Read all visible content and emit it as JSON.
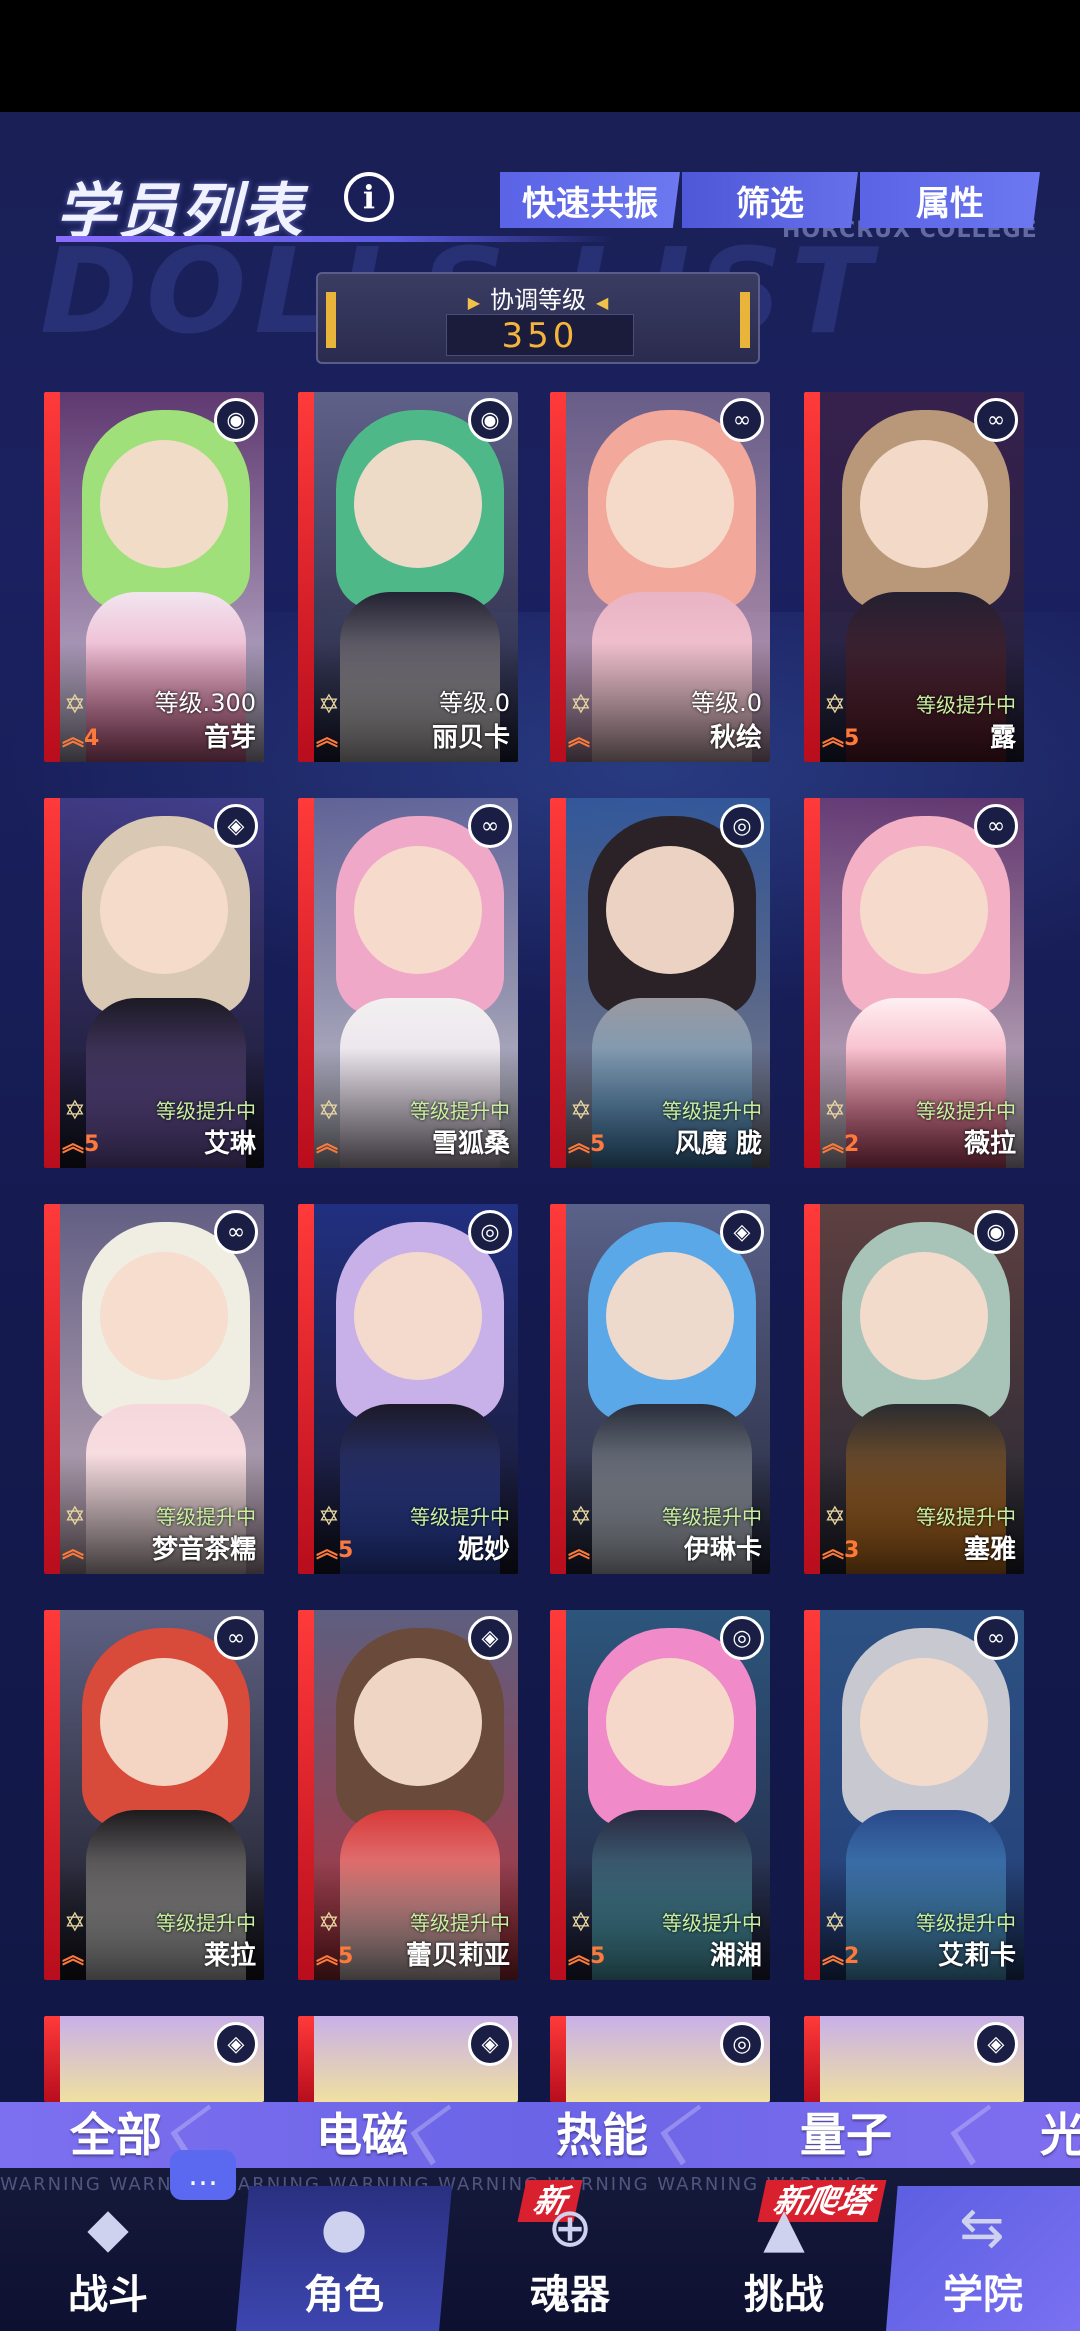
{
  "header": {
    "title": "学员列表",
    "subtitle_en": "HORCRUX COLLEGE",
    "watermark": "DOLLS LIST",
    "buttons": [
      "快速共振",
      "筛选",
      "属性"
    ]
  },
  "sync_level": {
    "label": "协调等级",
    "value": "350"
  },
  "characters": [
    {
      "name": "音芽",
      "status": "等级.300",
      "rank": "4",
      "element": "wifi-icon",
      "colors": [
        "#9fe07a",
        "#f2e6f0",
        "#e86a9a"
      ]
    },
    {
      "name": "丽贝卡",
      "status": "等级.0",
      "rank": "",
      "element": "wifi-icon",
      "colors": [
        "#4fb888",
        "#232232",
        "#e9e2e2"
      ]
    },
    {
      "name": "秋绘",
      "status": "等级.0",
      "rank": "",
      "element": "infinity-icon",
      "colors": [
        "#f2a89a",
        "#e9b4c4",
        "#ffd8e0"
      ]
    },
    {
      "name": "露",
      "status": "等级提升中",
      "rank": "5",
      "element": "infinity-icon",
      "colors": [
        "#b89878",
        "#242030",
        "#6e2230"
      ]
    },
    {
      "name": "艾琳",
      "status": "等级提升中",
      "rank": "5",
      "element": "diamond-icon",
      "colors": [
        "#d8c8b4",
        "#1c1a24",
        "#8a6ad0"
      ]
    },
    {
      "name": "雪狐桑",
      "status": "等级提升中",
      "rank": "",
      "element": "infinity-icon",
      "colors": [
        "#f0a8c8",
        "#f2f0f0",
        "#e0d0e8"
      ]
    },
    {
      "name": "风魔 胧",
      "status": "等级提升中",
      "rank": "5",
      "element": "spiral-icon",
      "colors": [
        "#2a2226",
        "#9a9aa0",
        "#4a9ad8"
      ]
    },
    {
      "name": "薇拉",
      "status": "等级提升中",
      "rank": "2",
      "element": "infinity-icon",
      "colors": [
        "#f4b0c4",
        "#fff0f2",
        "#e85078"
      ]
    },
    {
      "name": "梦音茶糯",
      "status": "等级提升中",
      "rank": "",
      "element": "infinity-icon",
      "colors": [
        "#f0ede2",
        "#f6d8dc",
        "#fbe6ea"
      ]
    },
    {
      "name": "妮妙",
      "status": "等级提升中",
      "rank": "5",
      "element": "spiral-icon",
      "colors": [
        "#c8b0e8",
        "#1c1a28",
        "#3a58e0"
      ]
    },
    {
      "name": "伊琳卡",
      "status": "等级提升中",
      "rank": "",
      "element": "diamond-icon",
      "colors": [
        "#5aa8e8",
        "#2a2e3c",
        "#e6eef8"
      ]
    },
    {
      "name": "塞雅",
      "status": "等级提升中",
      "rank": "3",
      "element": "wifi-icon",
      "colors": [
        "#a8c4b8",
        "#2a2c30",
        "#f08a20"
      ]
    },
    {
      "name": "莱拉",
      "status": "等级提升中",
      "rank": "",
      "element": "infinity-icon",
      "colors": [
        "#d84a3a",
        "#1c1a1c",
        "#f2f0f0"
      ]
    },
    {
      "name": "蕾贝莉亚",
      "status": "等级提升中",
      "rank": "5",
      "element": "diamond-icon",
      "colors": [
        "#6a4a3a",
        "#d83a3a",
        "#f2eaea"
      ]
    },
    {
      "name": "湘湘",
      "status": "等级提升中",
      "rank": "5",
      "element": "spiral-icon",
      "colors": [
        "#f08ac8",
        "#2a2840",
        "#60d0e0"
      ]
    },
    {
      "name": "艾莉卡",
      "status": "等级提升中",
      "rank": "2",
      "element": "infinity-icon",
      "colors": [
        "#c8c8d0",
        "#2a4a8a",
        "#60c0f0"
      ]
    }
  ],
  "partial_row_elements": [
    "diamond-icon",
    "diamond-icon",
    "spiral-icon",
    "diamond-icon"
  ],
  "filters": [
    "全部",
    "电磁",
    "热能",
    "量子",
    "光"
  ],
  "warning_text": "WARNING   WARNING   WARNING   WARNING   WARNING   WARNING   WARNING   WARNING",
  "nav": [
    {
      "label": "战斗",
      "icon": "battle-icon",
      "badge": ""
    },
    {
      "label": "角色",
      "icon": "characters-icon",
      "badge": ""
    },
    {
      "label": "魂器",
      "icon": "soul-vessel-icon",
      "badge": "新"
    },
    {
      "label": "挑战",
      "icon": "challenge-icon",
      "badge": "新爬塔"
    },
    {
      "label": "学院",
      "icon": "academy-icon",
      "badge": ""
    }
  ]
}
